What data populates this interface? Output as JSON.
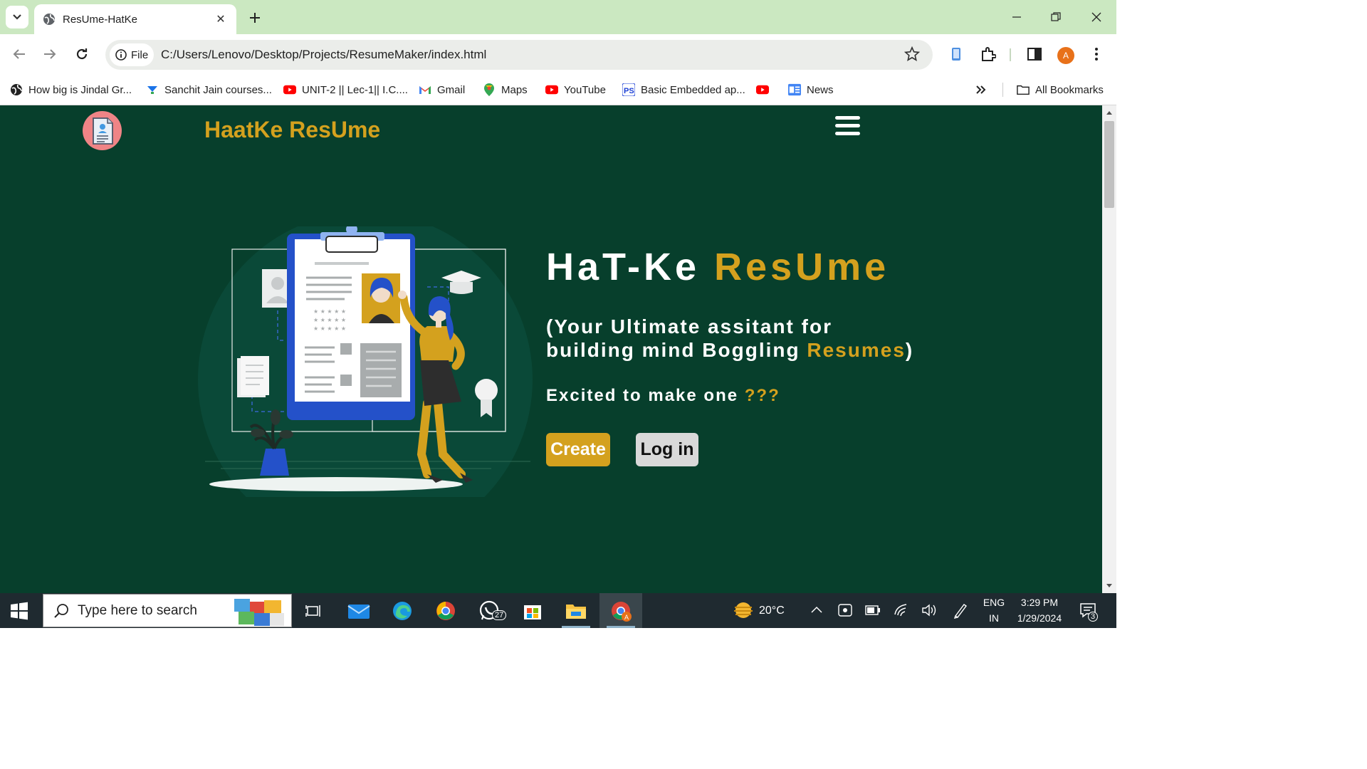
{
  "browser": {
    "tab_title": "ResUme-HatKe",
    "chip_label": "File",
    "url": "C:/Users/Lenovo/Desktop/Projects/ResumeMaker/index.html",
    "profile_initial": "A",
    "bookmarks": [
      {
        "label": "How big is Jindal Gr...",
        "icon": "globe-icon"
      },
      {
        "label": "Sanchit Jain courses...",
        "icon": "course-icon"
      },
      {
        "label": "UNIT-2 || Lec-1|| I.C....",
        "icon": "youtube-icon"
      },
      {
        "label": "Gmail",
        "icon": "gmail-icon"
      },
      {
        "label": "Maps",
        "icon": "maps-icon"
      },
      {
        "label": "YouTube",
        "icon": "youtube-icon"
      },
      {
        "label": "Basic Embedded ap...",
        "icon": "ps-icon"
      },
      {
        "label": "",
        "icon": "youtube-icon"
      },
      {
        "label": "News",
        "icon": "news-icon"
      }
    ],
    "all_bookmarks_label": "All Bookmarks"
  },
  "page": {
    "brand": "HaatKe ResUme",
    "hero_title_white": "HaT-Ke ",
    "hero_title_gold": "ResUme",
    "subtitle_line1": "(Your Ultimate assitant for",
    "subtitle_line2_white": "building mind Boggling ",
    "subtitle_line2_gold": "Resumes",
    "subtitle_close": ")",
    "excited_white": "Excited to make one ",
    "excited_gold": "???",
    "create_label": "Create",
    "login_label": "Log in"
  },
  "taskbar": {
    "search_placeholder": "Type here to search",
    "whatsapp_badge": "27",
    "temperature": "20°C",
    "lang_line1": "ENG",
    "lang_line2": "IN",
    "time": "3:29 PM",
    "date": "1/29/2024",
    "notification_count": "3"
  },
  "colors": {
    "page_bg": "#073f2c",
    "accent_gold": "#d4a11e",
    "tabbar_bg": "#cbe8c1"
  }
}
